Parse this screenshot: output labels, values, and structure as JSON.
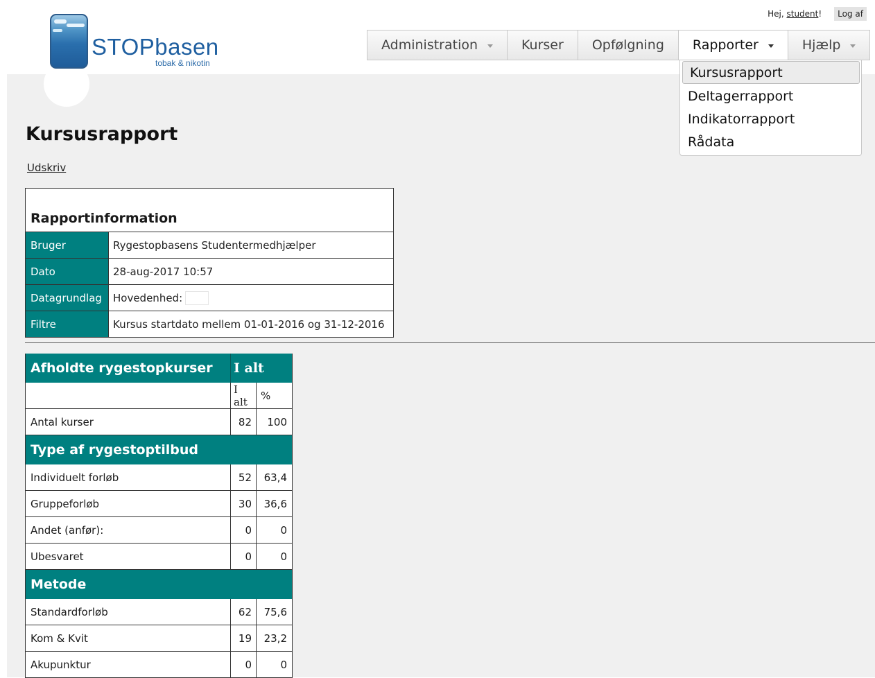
{
  "header": {
    "logo": {
      "brand": "STOPbasen",
      "tagline": "tobak & nikotin"
    },
    "greeting": "Hej,",
    "username": "student",
    "greeting_suffix": "!",
    "logout": "Log af"
  },
  "nav": {
    "items": [
      {
        "label": "Administration",
        "has_caret": true
      },
      {
        "label": "Kurser",
        "has_caret": false
      },
      {
        "label": "Opfølgning",
        "has_caret": false
      },
      {
        "label": "Rapporter",
        "has_caret": true,
        "active": true
      },
      {
        "label": "Hjælp",
        "has_caret": true
      }
    ],
    "dropdown": {
      "items": [
        "Kursusrapport",
        "Deltagerrapport",
        "Indikatorrapport",
        "Rådata"
      ],
      "selected": "Kursusrapport"
    }
  },
  "page": {
    "title": "Kursusrapport",
    "print_link": "Udskriv"
  },
  "report_info": {
    "title": "Rapportinformation",
    "rows": [
      {
        "label": "Bruger",
        "value": "Rygestopbasens Studentermedhjælper"
      },
      {
        "label": "Dato",
        "value": "28-aug-2017 10:57"
      },
      {
        "label": "Datagrundlag",
        "value": "Hovedenhed:"
      },
      {
        "label": "Filtre",
        "value": "Kursus startdato mellem 01-01-2016 og 31-12-2016"
      }
    ]
  },
  "stats": {
    "header": {
      "title": "Afholdte rygestopkurser",
      "total": "I alt"
    },
    "subheader": {
      "count": "I alt",
      "pct": "%"
    },
    "antal": {
      "label": "Antal kurser",
      "count": "82",
      "pct": "100"
    },
    "sections": [
      {
        "title": "Type af rygestoptilbud",
        "rows": [
          {
            "label": "Individuelt forløb",
            "count": "52",
            "pct": "63,4"
          },
          {
            "label": "Gruppeforløb",
            "count": "30",
            "pct": "36,6"
          },
          {
            "label": "Andet (anfør):",
            "count": "0",
            "pct": "0"
          },
          {
            "label": "Ubesvaret",
            "count": "0",
            "pct": "0"
          }
        ]
      },
      {
        "title": "Metode",
        "rows": [
          {
            "label": "Standardforløb",
            "count": "62",
            "pct": "75,6"
          },
          {
            "label": "Kom & Kvit",
            "count": "19",
            "pct": "23,2"
          },
          {
            "label": "Akupunktur",
            "count": "0",
            "pct": "0"
          }
        ]
      }
    ]
  },
  "colors": {
    "teal": "#008080",
    "content_bg": "#f0f0f0",
    "brand_blue": "#1f5fa0"
  }
}
